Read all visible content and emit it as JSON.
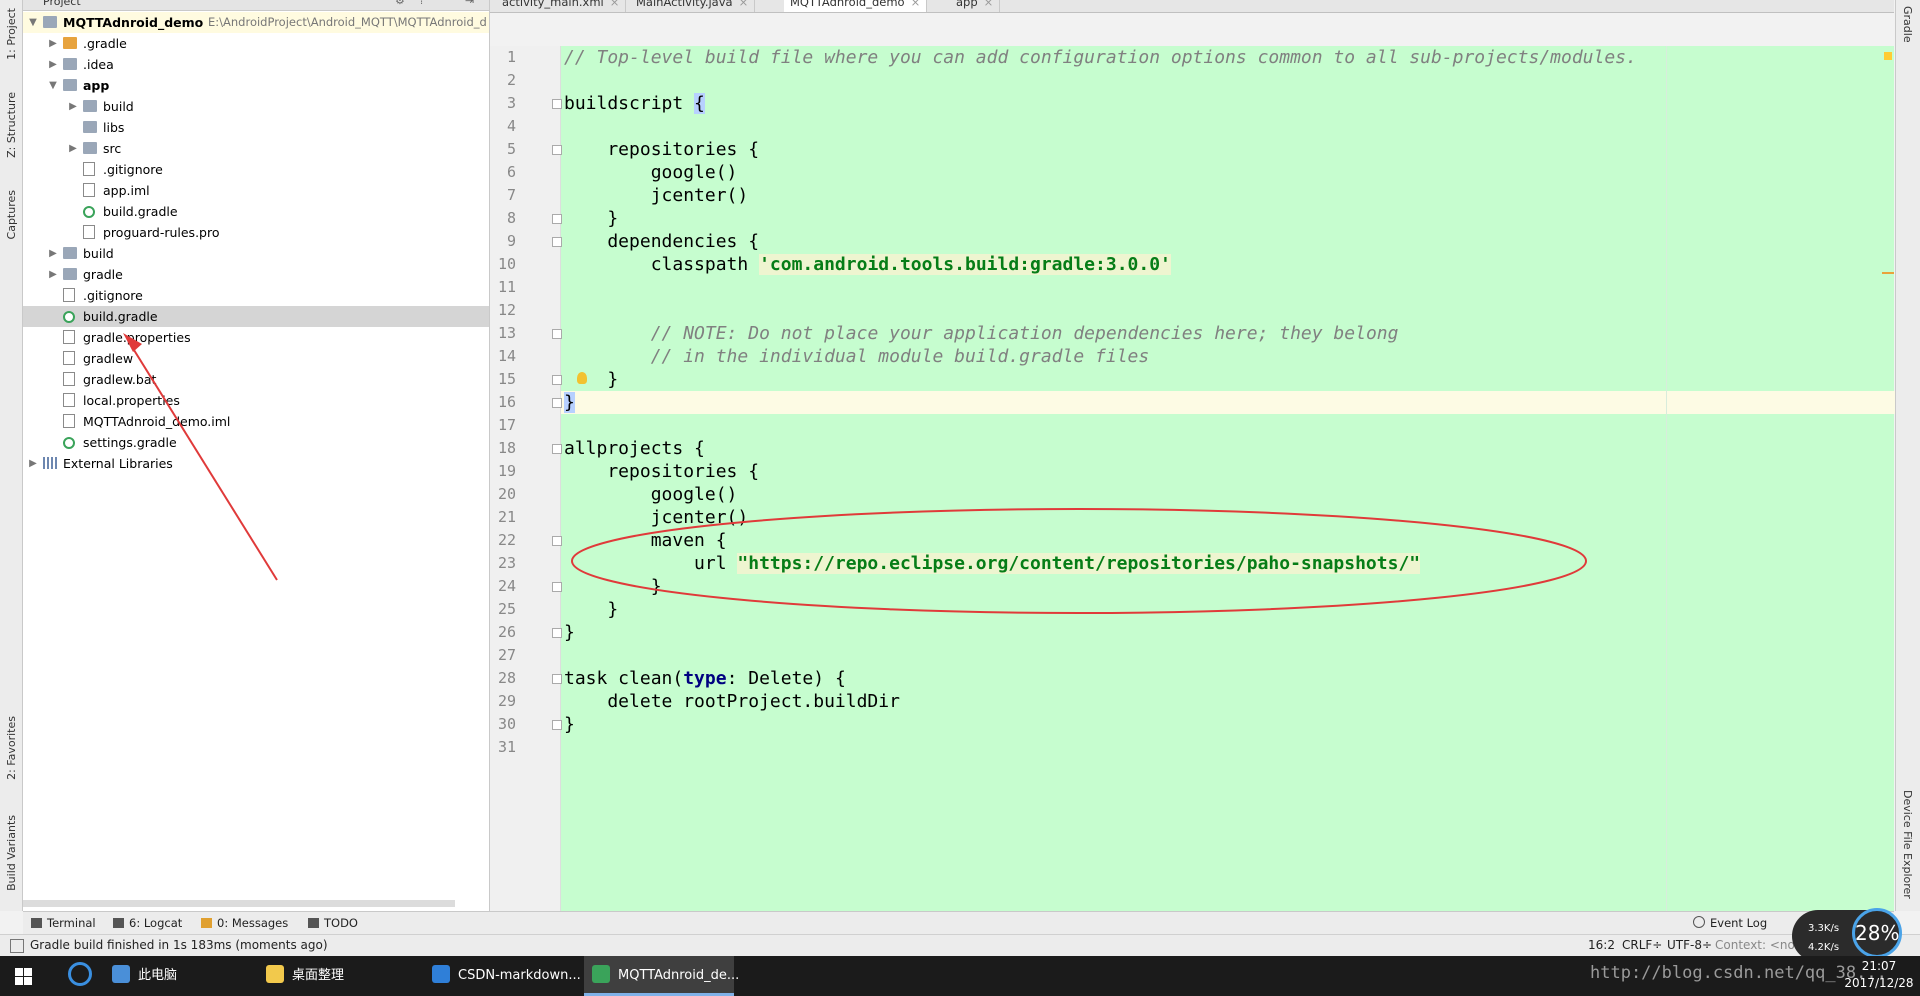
{
  "left_strip": {
    "tabs": [
      "1: Project",
      "Z: Structure",
      "Captures",
      "2: Favorites",
      "Build Variants"
    ]
  },
  "right_strip": {
    "tabs": [
      "Gradle",
      "Device File Explorer"
    ]
  },
  "project": {
    "header_label": "Project",
    "tree": [
      {
        "label": "MQTTAdnroid_demo",
        "path": "E:\\AndroidProject\\Android_MQTT\\MQTTAdnroid_d",
        "arrow": "▼",
        "icon": "folder-icon",
        "bold": true
      },
      {
        "label": ".gradle",
        "arrow": "▶",
        "icon": "folder-icon"
      },
      {
        "label": ".idea",
        "arrow": "▶",
        "icon": "folder-icon"
      },
      {
        "label": "app",
        "arrow": "▼",
        "icon": "folder-icon",
        "bold": true
      },
      {
        "label": "build",
        "arrow": "▶",
        "icon": "folder-icon"
      },
      {
        "label": "libs",
        "arrow": "",
        "icon": "folder-icon"
      },
      {
        "label": "src",
        "arrow": "▶",
        "icon": "folder-icon"
      },
      {
        "label": ".gitignore",
        "arrow": "",
        "icon": "file-icon"
      },
      {
        "label": "app.iml",
        "arrow": "",
        "icon": "file-icon"
      },
      {
        "label": "build.gradle",
        "arrow": "",
        "icon": "gradle-icon"
      },
      {
        "label": "proguard-rules.pro",
        "arrow": "",
        "icon": "file-icon"
      },
      {
        "label": "build",
        "arrow": "▶",
        "icon": "folder-icon"
      },
      {
        "label": "gradle",
        "arrow": "▶",
        "icon": "folder-icon"
      },
      {
        "label": ".gitignore",
        "arrow": "",
        "icon": "file-icon"
      },
      {
        "label": "build.gradle",
        "arrow": "",
        "icon": "gradle-icon",
        "selected": true
      },
      {
        "label": "gradle.properties",
        "arrow": "",
        "icon": "file-icon"
      },
      {
        "label": "gradlew",
        "arrow": "",
        "icon": "file-icon"
      },
      {
        "label": "gradlew.bat",
        "arrow": "",
        "icon": "file-icon"
      },
      {
        "label": "local.properties",
        "arrow": "",
        "icon": "file-icon"
      },
      {
        "label": "MQTTAdnroid_demo.iml",
        "arrow": "",
        "icon": "file-icon"
      },
      {
        "label": "settings.gradle",
        "arrow": "",
        "icon": "gradle-icon"
      },
      {
        "label": "External Libraries",
        "arrow": "▶",
        "icon": "library-icon"
      }
    ]
  },
  "editor": {
    "tabs": [
      {
        "label": "activity_main.xml",
        "active": false
      },
      {
        "label": "MainActivity.java",
        "active": false
      },
      {
        "label": "MQTTAdnroid_demo",
        "active": true
      },
      {
        "label": "app",
        "active": false
      }
    ],
    "lines": [
      "// Top-level build file where you can add configuration options common to all sub-projects/modules.",
      "",
      "buildscript {",
      "",
      "    repositories {",
      "        google()",
      "        jcenter()",
      "    }",
      "    dependencies {",
      "        classpath 'com.android.tools.build:gradle:3.0.0'",
      "",
      "",
      "        // NOTE: Do not place your application dependencies here; they belong",
      "        // in the individual module build.gradle files",
      "    }",
      "}",
      "",
      "allprojects {",
      "    repositories {",
      "        google()",
      "        jcenter()",
      "        maven {",
      "            url \"https://repo.eclipse.org/content/repositories/paho-snapshots/\"",
      "        }",
      "    }",
      "}",
      "",
      "task clean(type: Delete) {",
      "    delete rootProject.buildDir",
      "}",
      ""
    ],
    "current_line": 16
  },
  "tool_windows": [
    {
      "label": "Terminal",
      "icon": "terminal-icon"
    },
    {
      "label": "6: Logcat",
      "icon": "logcat-icon"
    },
    {
      "label": "0: Messages",
      "icon": "messages-icon"
    },
    {
      "label": "TODO",
      "icon": "todo-icon"
    }
  ],
  "event_log": "Event Log",
  "status": {
    "message": "Gradle build finished in 1s 183ms (moments ago)",
    "position": "16:2",
    "line_sep": "CRLF÷",
    "encoding": "UTF-8÷",
    "context": "Context: <no"
  },
  "taskbar": {
    "items": [
      {
        "label": "此电脑",
        "color": "#4a8fd8"
      },
      {
        "label": "桌面整理",
        "color": "#f2c94c"
      },
      {
        "label": "CSDN-markdown...",
        "color": "#2f7fd8"
      },
      {
        "label": "MQTTAdnroid_de...",
        "color": "#3aa35a",
        "active": true
      }
    ],
    "time": "21:07",
    "date": "2017/12/28",
    "watermark": "http://blog.csdn.net/qq_38..."
  },
  "net_widget": {
    "up": "3.3K/s",
    "down": "4.2K/s",
    "cpu": "28%"
  }
}
